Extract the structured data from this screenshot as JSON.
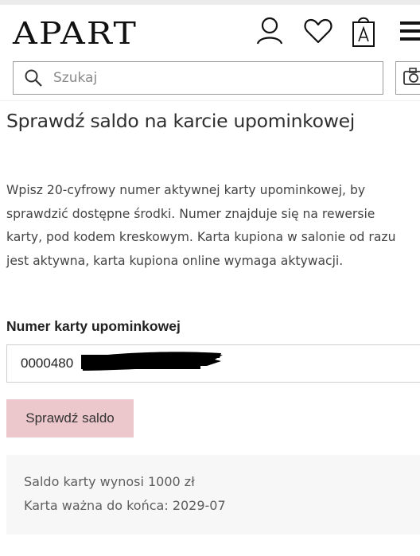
{
  "header": {
    "logo_text": "APART",
    "icons": [
      "user-icon",
      "heart-icon",
      "shopping-bag-icon",
      "hamburger-menu-icon"
    ]
  },
  "search": {
    "placeholder": "Szukaj",
    "icon": "search-icon",
    "camera_icon": "camera-icon"
  },
  "main": {
    "title": "Sprawdź saldo na karcie upominkowej",
    "description_lines": [
      "Wpisz 20-cyfrowy numer aktywnej karty upominkowej, by",
      "sprawdzić dostępne środki. Numer znajduje się na rewersie",
      "karty, pod kodem kreskowym. Karta kupiona w salonie od razu",
      "jest aktywna, karta kupiona online wymaga aktywacji."
    ],
    "card_field": {
      "label": "Numer karty upominkowej",
      "value": "0000480"
    },
    "check_button_label": "Sprawdź saldo",
    "result": {
      "balance_text": "Saldo karty wynosi 1000 zł",
      "validity_text": "Karta ważna do końca: 2029-07"
    }
  },
  "colors": {
    "button_bg": "#ecc7cc",
    "result_bg": "#f7f7f7",
    "text_dark": "#2f2f2f"
  }
}
